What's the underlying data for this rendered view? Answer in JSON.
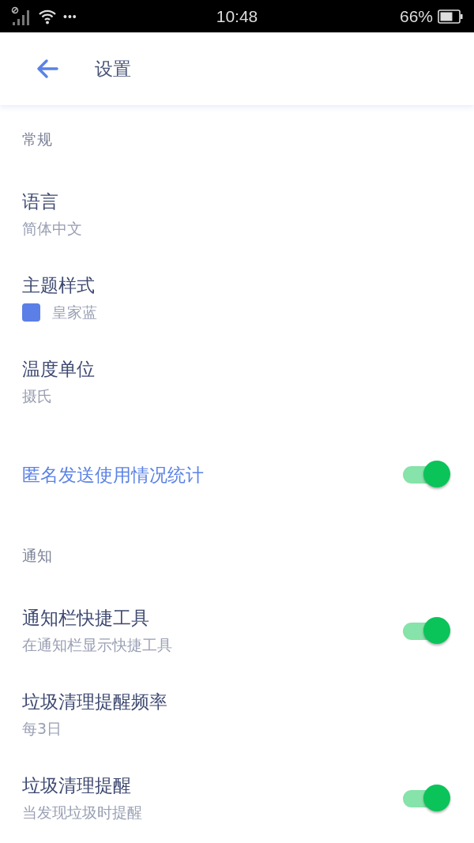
{
  "status_bar": {
    "time": "10:48",
    "battery_text": "66%",
    "more": "•••"
  },
  "header": {
    "title": "设置"
  },
  "sections": [
    {
      "title": "常规",
      "items": [
        {
          "kind": "value",
          "title": "语言",
          "subtitle": "简体中文",
          "highlighted": false
        },
        {
          "kind": "swatch",
          "title": "主题样式",
          "subtitle": "皇家蓝",
          "color": "#5b7fe6",
          "highlighted": false
        },
        {
          "kind": "value",
          "title": "温度单位",
          "subtitle": "摄氏",
          "highlighted": false
        },
        {
          "kind": "toggle",
          "title": "匿名发送使用情况统计",
          "on": true,
          "highlighted": true
        }
      ]
    },
    {
      "title": "通知",
      "items": [
        {
          "kind": "toggle",
          "title": "通知栏快捷工具",
          "subtitle": "在通知栏显示快捷工具",
          "on": true,
          "highlighted": false
        },
        {
          "kind": "value",
          "title": "垃圾清理提醒频率",
          "subtitle": "每3日",
          "highlighted": false
        },
        {
          "kind": "toggle",
          "title": "垃圾清理提醒",
          "subtitle": "当发现垃圾时提醒",
          "on": true,
          "highlighted": false
        }
      ]
    }
  ]
}
